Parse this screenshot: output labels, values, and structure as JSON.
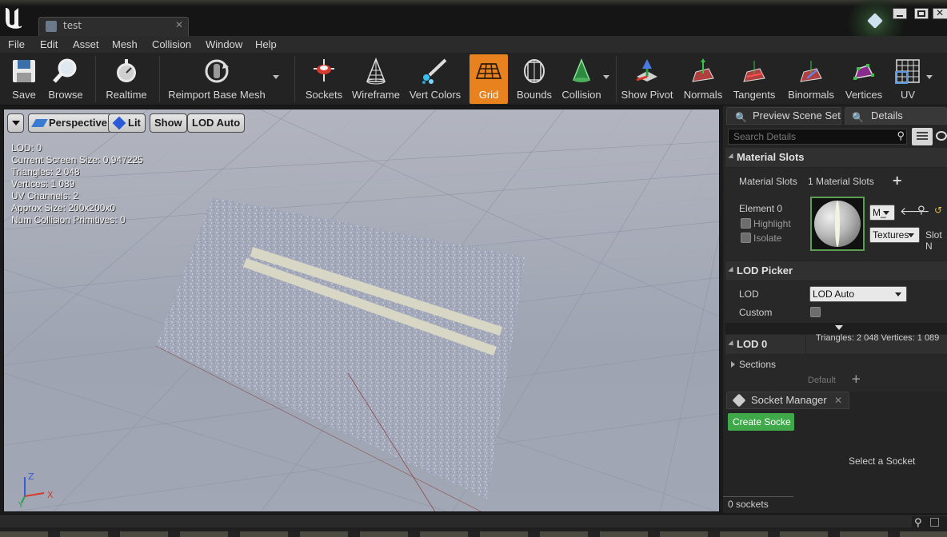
{
  "window": {
    "tab_title": "test"
  },
  "menubar": {
    "items": [
      "File",
      "Edit",
      "Asset",
      "Mesh",
      "Collision",
      "Window",
      "Help"
    ]
  },
  "toolbar": {
    "buttons": [
      {
        "label": "Save",
        "icon": "save-icon"
      },
      {
        "label": "Browse",
        "icon": "browse-icon"
      },
      {
        "label": "Realtime",
        "icon": "realtime-icon"
      },
      {
        "label": "Reimport Base Mesh",
        "icon": "reimport-icon"
      },
      {
        "label": "Sockets",
        "icon": "sockets-icon"
      },
      {
        "label": "Wireframe",
        "icon": "wireframe-icon"
      },
      {
        "label": "Vert Colors",
        "icon": "vert-colors-icon"
      },
      {
        "label": "Grid",
        "icon": "grid-icon"
      },
      {
        "label": "Bounds",
        "icon": "bounds-icon"
      },
      {
        "label": "Collision",
        "icon": "collision-icon"
      },
      {
        "label": "Show Pivot",
        "icon": "pivot-icon"
      },
      {
        "label": "Normals",
        "icon": "normals-icon"
      },
      {
        "label": "Tangents",
        "icon": "tangents-icon"
      },
      {
        "label": "Binormals",
        "icon": "binormals-icon"
      },
      {
        "label": "Vertices",
        "icon": "vertices-icon"
      },
      {
        "label": "UV",
        "icon": "uv-icon"
      }
    ],
    "active": "Grid",
    "accent": "#e8821e"
  },
  "viewport": {
    "perspective_label": "Perspective",
    "lit_label": "Lit",
    "show_label": "Show",
    "lod_label": "LOD Auto",
    "stats": [
      "LOD:  0",
      "Current Screen Size:  0,947225",
      "Triangles:  2 048",
      "Vertices:  1 089",
      "UV Channels:  2",
      "Approx Size: 200x200x0",
      "Num Collision Primitives:  0"
    ],
    "axis": {
      "z": "Z",
      "x": "X",
      "y": "Y"
    }
  },
  "details": {
    "tab_preview": "Preview Scene Set",
    "tab_details": "Details",
    "search_placeholder": "Search Details",
    "material_slots": {
      "header": "Material Slots",
      "label": "Material Slots",
      "count": "1 Material Slots",
      "element": "Element 0",
      "highlight": "Highlight",
      "isolate": "Isolate",
      "material_name": "M_",
      "textures": "Textures",
      "slot_name": "Slot N"
    },
    "lod_picker": {
      "header": "LOD Picker",
      "lod_label": "LOD",
      "lod_value": "LOD Auto",
      "custom_label": "Custom"
    },
    "lod0": {
      "header": "LOD 0",
      "info": "Triangles: 2 048   Vertices: 1 089",
      "sections": "Sections",
      "default": "Default"
    }
  },
  "sockets": {
    "tab": "Socket Manager",
    "create_button": "Create Socke",
    "select_text": "Select a Socket",
    "count": "0 sockets"
  }
}
